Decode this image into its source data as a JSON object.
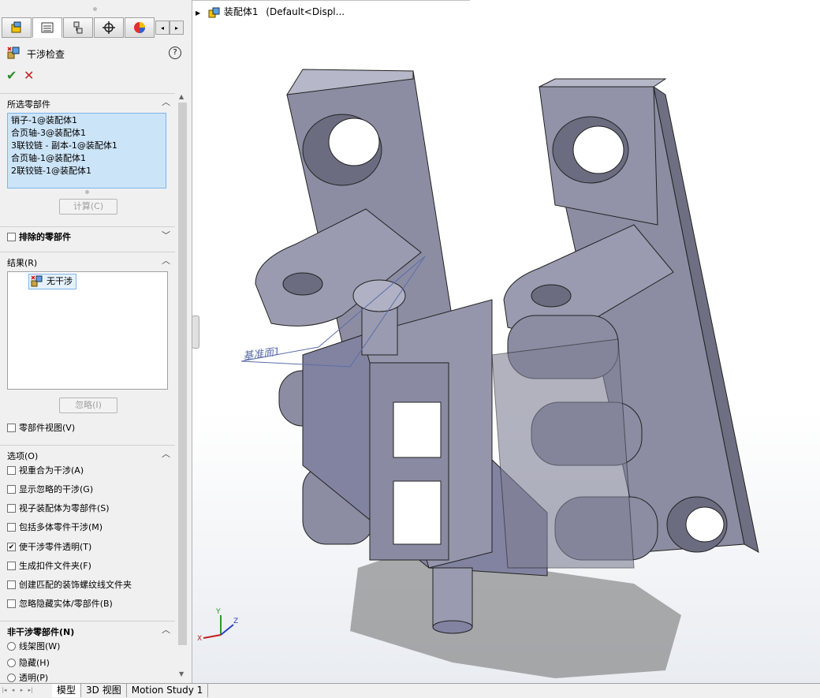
{
  "tabs": [
    "feature-manager",
    "property-manager",
    "configuration-manager",
    "dimxpert-manager",
    "display-manager"
  ],
  "feature": {
    "title": "干涉检查",
    "help": "?",
    "ok": "✔",
    "cancel": "✕"
  },
  "selected": {
    "header": "所选零部件",
    "items": [
      "销子-1@装配体1",
      "合页轴-3@装配体1",
      "3联铰链 - 副本-1@装配体1",
      "合页轴-1@装配体1",
      "2联铰链-1@装配体1"
    ],
    "calc_button": "计算(C)"
  },
  "excluded": {
    "label": "排除的零部件"
  },
  "results": {
    "header": "结果(R)",
    "item": "无干涉",
    "ignore_button": "忽略(I)",
    "component_view": "零部件视图(V)"
  },
  "options": {
    "header": "选项(O)",
    "items": [
      {
        "label": "视重合为干涉(A)",
        "checked": false
      },
      {
        "label": "显示忽略的干涉(G)",
        "checked": false
      },
      {
        "label": "视子装配体为零部件(S)",
        "checked": false
      },
      {
        "label": "包括多体零件干涉(M)",
        "checked": false
      },
      {
        "label": "使干涉零件透明(T)",
        "checked": true
      },
      {
        "label": "生成扣件文件夹(F)",
        "checked": false
      },
      {
        "label": "创建匹配的装饰螺纹线文件夹",
        "checked": false
      },
      {
        "label": "忽略隐藏实体/零部件(B)",
        "checked": false
      }
    ]
  },
  "non_interfering": {
    "header": "非干涉零部件(N)",
    "items": [
      "线架图(W)",
      "隐藏(H)",
      "透明(P)"
    ]
  },
  "tree": {
    "name": "装配体1",
    "config": "(Default<Displ..."
  },
  "viewport": {
    "plane_label": "基准面1",
    "part_color": "#8e8fa6",
    "axis_labels": [
      "Y",
      "Z",
      "X"
    ]
  },
  "bottom_tabs": [
    "模型",
    "3D 视图",
    "Motion Study 1"
  ],
  "colors": {
    "accent": "#cce4f7",
    "ok": "#2c8c2c",
    "cancel": "#c42020"
  }
}
